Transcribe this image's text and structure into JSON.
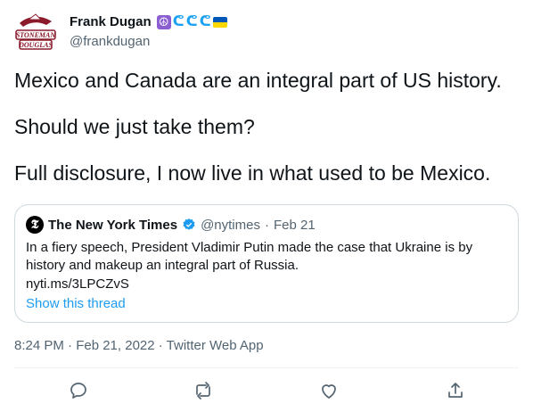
{
  "author": {
    "name": "Frank Dugan",
    "handle": "@frankdugan",
    "avatar_text": "STONEMAN DOUGLAS",
    "badges": [
      "peace-symbol-icon",
      "wave-icon",
      "wave-icon",
      "wave-icon",
      "ukraine-flag-icon"
    ]
  },
  "tweet": {
    "paragraphs": [
      "Mexico and Canada are an integral part of US history.",
      "Should we just take them?",
      "Full disclosure, I now live in what used to be Mexico."
    ]
  },
  "quote": {
    "name": "The New York Times",
    "handle": "@nytimes",
    "separator": "·",
    "date": "Feb 21",
    "text": "In a fiery speech, President Vladimir Putin made the case that Ukraine is by history and makeup an integral part of Russia.",
    "link": "nyti.ms/3LPCZvS",
    "show_thread": "Show this thread"
  },
  "meta": {
    "text": "8:24 PM · Feb 21, 2022 · Twitter Web App"
  },
  "colors": {
    "accent": "#1d9bf0",
    "secondary_text": "#536471",
    "border": "#cfd9de"
  },
  "actions": [
    "reply-icon",
    "retweet-icon",
    "like-icon",
    "share-icon"
  ]
}
